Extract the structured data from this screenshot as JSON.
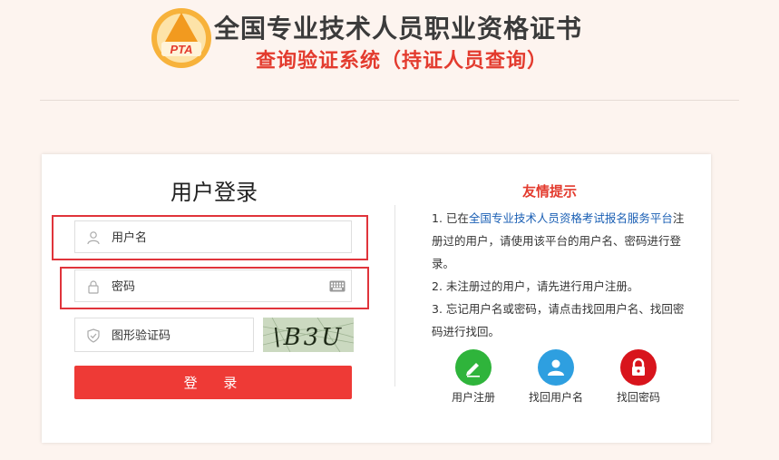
{
  "header": {
    "logo_text": "PTA",
    "title": "全国专业技术人员职业资格证书",
    "subtitle": "查询验证系统（持证人员查询）"
  },
  "login": {
    "title": "用户登录",
    "username_placeholder": "用户名",
    "password_placeholder": "密码",
    "captcha_placeholder": "图形验证码",
    "captcha_text": "\\B3U",
    "submit_label": "登 录"
  },
  "tips": {
    "title": "友情提示",
    "item1_prefix": "1. 已在",
    "item1_link": "全国专业技术人员资格考试报名服务平台",
    "item1_suffix": "注册过的用户，请使用该平台的用户名、密码进行登录。",
    "item2": "2. 未注册过的用户，请先进行用户注册。",
    "item3": "3. 忘记用户名或密码，请点击找回用户名、找回密码进行找回。"
  },
  "actions": [
    {
      "label": "用户注册",
      "icon": "pencil-icon",
      "color": "#2fb43b"
    },
    {
      "label": "找回用户名",
      "icon": "user-icon",
      "color": "#2e9fe0"
    },
    {
      "label": "找回密码",
      "icon": "lock-icon",
      "color": "#d8141c"
    }
  ]
}
